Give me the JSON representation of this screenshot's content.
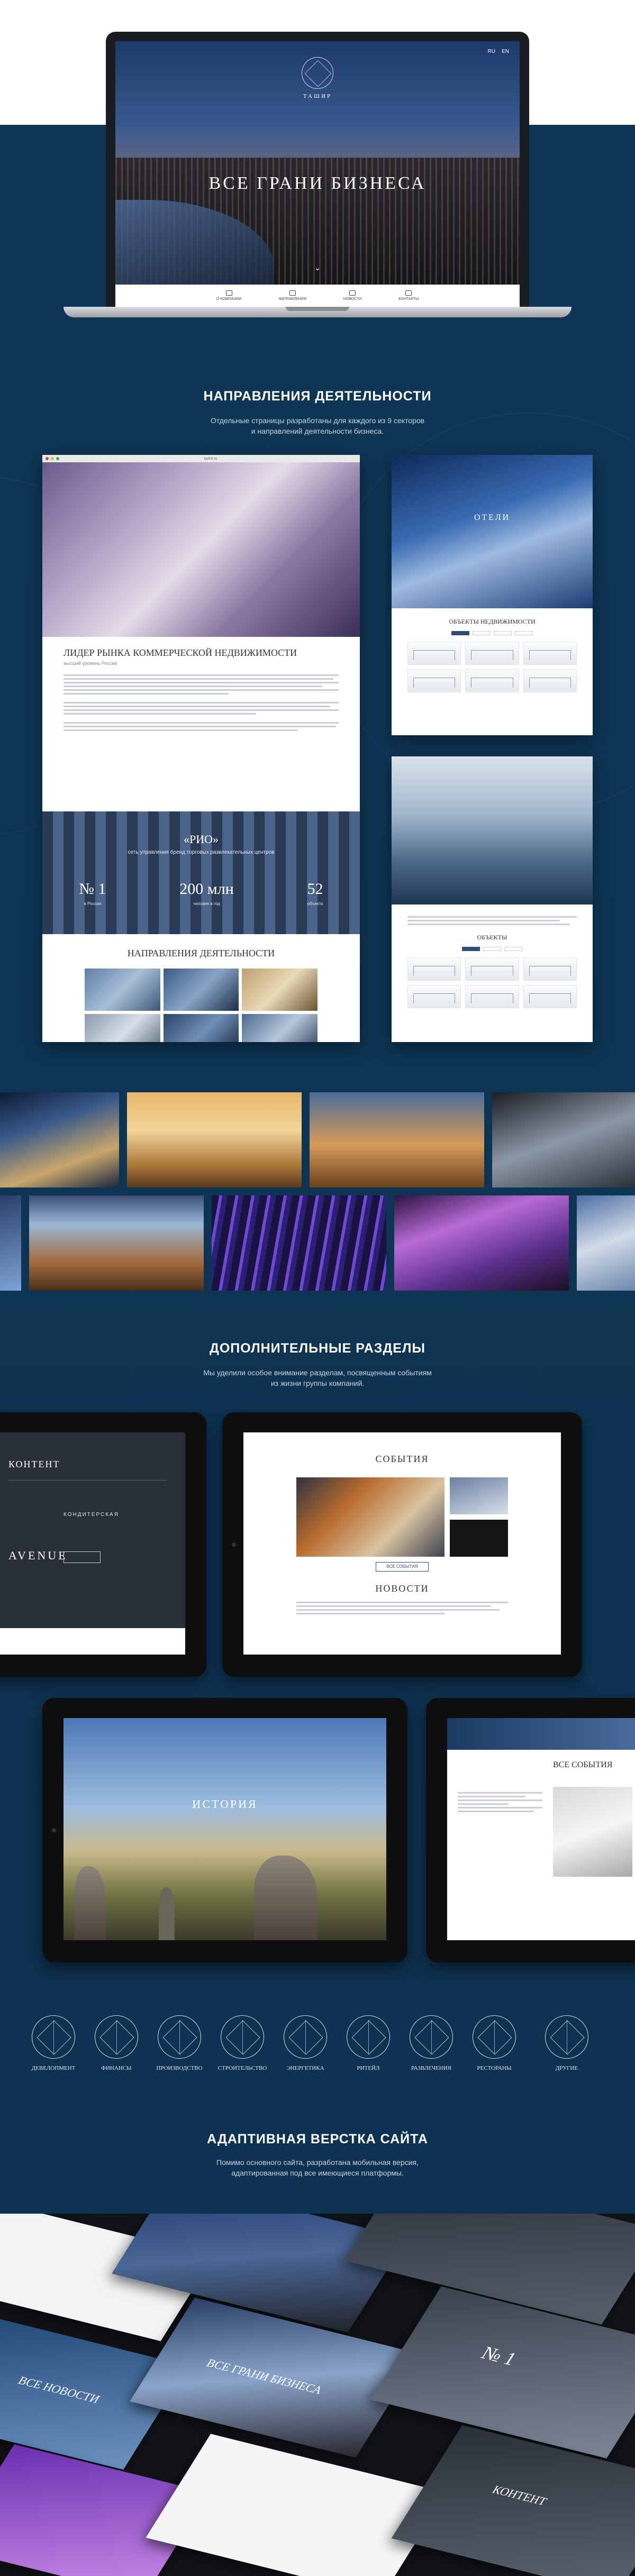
{
  "hero": {
    "brand": "ТАШИР",
    "title": "ВСЕ ГРАНИ БИЗНЕСА",
    "nav": [
      "RU",
      "EN"
    ],
    "menu": [
      "О КОМПАНИИ",
      "НАПРАВЛЕНИЯ",
      "НОВОСТИ",
      "КОНТАКТЫ"
    ]
  },
  "section1": {
    "title": "НАПРАВЛЕНИЯ ДЕЯТЕЛЬНОСТИ",
    "subtitle_line1": "Отдельные страницы разработаны для каждого из 9 секторов",
    "subtitle_line2": "и направлений деятельности бизнеса."
  },
  "mock_main": {
    "url": "tashir.ru",
    "heading": "ЛИДЕР РЫНКА КОММЕРЧЕСКОЙ НЕДВИЖИМОСТИ",
    "subheading": "высший уровень России",
    "rio_label": "«РИО»",
    "rio_sub": "сеть управления бренд торговых развлекательных центров",
    "stats": [
      {
        "value": "№ 1",
        "label": "в России"
      },
      {
        "value": "200 млн",
        "label": "человек в год"
      },
      {
        "value": "52",
        "label": "объекта"
      }
    ],
    "directions_title": "НАПРАВЛЕНИЯ ДЕЯТЕЛЬНОСТИ"
  },
  "mock_hotels": {
    "label": "ОТЕЛИ",
    "objects_title": "ОБЪЕКТЫ НЕДВИЖИМОСТИ"
  },
  "mock_objects": {
    "objects_title": "ОБЪЕКТЫ"
  },
  "section2": {
    "title": "ДОПОЛНИТЕЛЬНЫЕ РАЗДЕЛЫ",
    "subtitle_line1": "Мы уделили особое внимание разделам, посвященным событиям",
    "subtitle_line2": "из жизни группы компаний."
  },
  "tablet_content": {
    "title": "КОНТЕНТ",
    "brand": "AVENUE",
    "tag": "КОНДИТЕРСКАЯ"
  },
  "tablet_events": {
    "title": "СОБЫТИЯ",
    "news_title": "НОВОСТИ",
    "button": "ВСЕ СОБЫТИЯ"
  },
  "tablet_history": {
    "title": "ИСТОРИЯ"
  },
  "tablet_all_events": {
    "title": "ВСЕ СОБЫТИЯ"
  },
  "categories": [
    {
      "label": "ДЕВЕЛОПМЕНТ"
    },
    {
      "label": "ФИНАНСЫ"
    },
    {
      "label": "ПРОИЗВОДСТВО"
    },
    {
      "label": "СТРОИТЕЛЬСТВО"
    },
    {
      "label": "ЭНЕРГЕТИКА"
    },
    {
      "label": "РИТЕЙЛ"
    },
    {
      "label": "РАЗВЛЕЧЕНИЯ"
    },
    {
      "label": "РЕСТОРАНЫ"
    },
    {
      "label": "ДРУГИЕ"
    }
  ],
  "section3": {
    "title": "АДАПТИВНАЯ ВЕРСТКА САЙТА",
    "subtitle_line1": "Помимо основного сайта, разработана мобильная версия,",
    "subtitle_line2": "адаптированная под все имеющиеся платформы."
  },
  "collage": {
    "news_title": "ВСЕ НОВОСТИ",
    "hero_title": "ВСЕ ГРАНИ БИЗНЕСА",
    "content_title": "КОНТЕНТ",
    "stat": "№ 1"
  },
  "colors": {
    "accent": "#0f3350",
    "menu_icon": "#2f4d77"
  }
}
